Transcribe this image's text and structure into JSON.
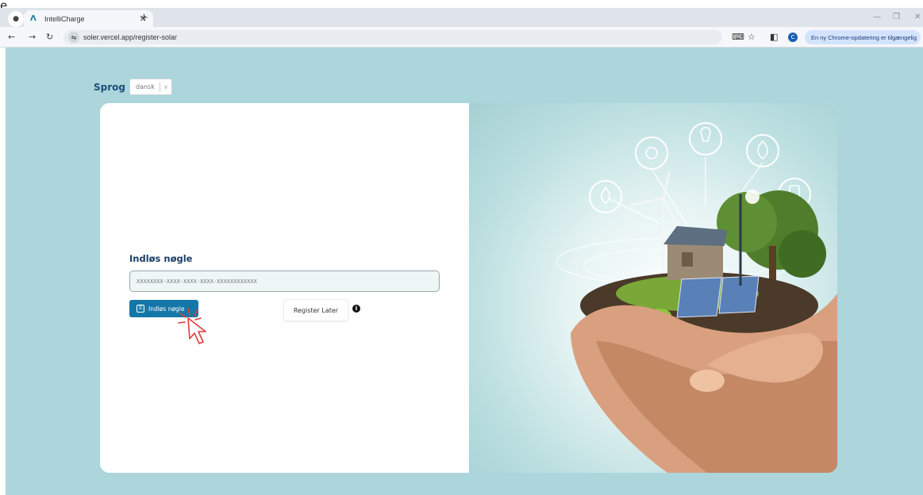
{
  "stray_text": "e.",
  "browser": {
    "tab_title": "IntelliCharge",
    "url": "soler.vercel.app/register-solar",
    "profile_initial": "C",
    "update_notice": "En ny Chrome-opdatering er tilgængelig"
  },
  "language": {
    "label": "Sprog",
    "selected": "dansk"
  },
  "form": {
    "title": "Indløs nøgle",
    "key_placeholder": "XXXXXXXX-XXXX-XXXX-XXXX-XXXXXXXXXXXX",
    "redeem_label": "Indløs nøgle",
    "later_label": "Register Later",
    "info_glyph": "i"
  },
  "colors": {
    "page_bg": "#acd5dc",
    "primary": "#1577a8",
    "title": "#1d3f66"
  },
  "icons": [
    "app-logo-icon",
    "close-icon",
    "plus-icon",
    "back-icon",
    "forward-icon",
    "reload-icon",
    "site-info-icon",
    "translate-icon",
    "star-icon",
    "sidepanel-icon",
    "chevron-down-icon",
    "key-icon",
    "info-icon",
    "cursor-click-icon"
  ]
}
